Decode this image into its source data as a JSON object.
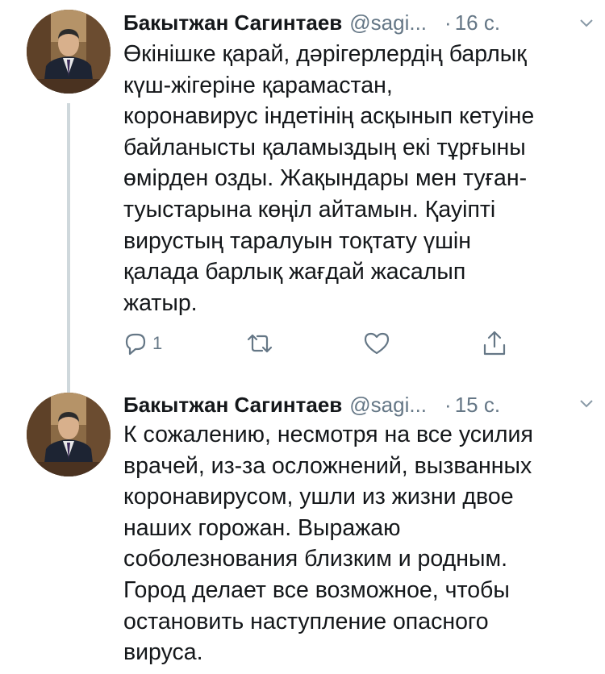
{
  "colors": {
    "text": "#14171a",
    "secondary": "#657786",
    "thread_line": "#cfd8dc"
  },
  "tweets": [
    {
      "name": "Бакытжан Сагинтаев",
      "handle": "@sagi...",
      "dot": "·",
      "time": "16 с.",
      "text_lines": [
        "Өкінішке қарай, дәрігерлердің барлық",
        "күш-жігеріне қарамастан,",
        "коронавирус індетінің асқынып кетуіне",
        "байланысты қаламыздың екі тұрғыны",
        "өмірден озды. Жақындары мен туған-",
        "туыстарына көңіл айтамын. Қауіпті",
        "вирустың таралуын тоқтату үшін",
        "қалада барлық жағдай жасалып",
        "жатыр."
      ],
      "reply_count": "1",
      "icons": [
        "reply-icon",
        "retweet-icon",
        "like-icon",
        "share-icon",
        "chevron-down-icon"
      ]
    },
    {
      "name": "Бакытжан Сагинтаев",
      "handle": "@sagi...",
      "dot": "·",
      "time": "15 с.",
      "text_lines": [
        "К сожалению, несмотря на все усилия",
        "врачей, из-за осложнений, вызванных",
        "коронавирусом, ушли из жизни двое",
        "наших горожан. Выражаю",
        "соболезнования близким и родным.",
        "Город делает все возможное, чтобы",
        "остановить наступление опасного",
        "вируса."
      ],
      "icons": [
        "chevron-down-icon"
      ]
    }
  ]
}
